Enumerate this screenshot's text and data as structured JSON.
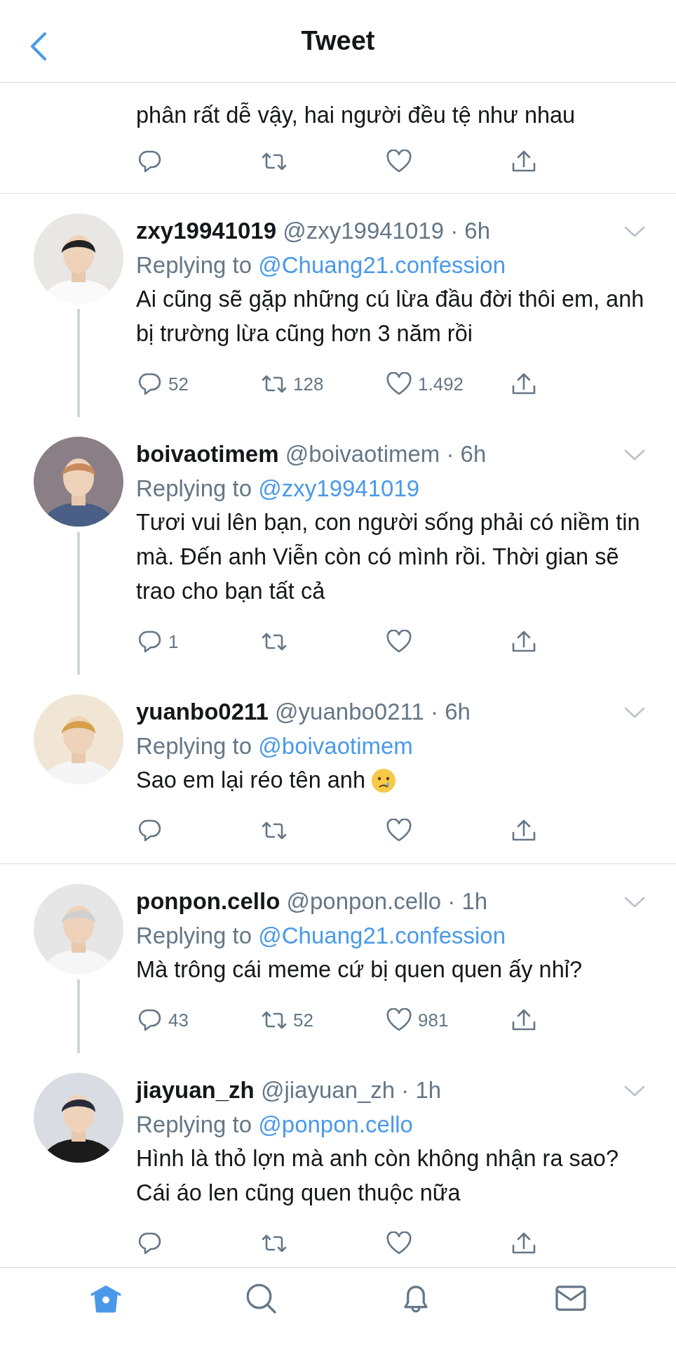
{
  "header": {
    "title": "Tweet"
  },
  "partial_tweet": {
    "body": "phân rất dễ vậy, hai người đều tệ như nhau"
  },
  "threads": [
    {
      "tweets": [
        {
          "name": "zxy19941019",
          "meta": "@zxy19941019 · 6h",
          "replying_label": "Replying to",
          "replying_to": "@Chuang21.confession",
          "body": "Ai cũng sẽ gặp những cú lừa đầu đời thôi em, anh bị trường lừa cũng hơn 3 năm rồi",
          "emoji": false,
          "thread_line": true,
          "replies": "52",
          "retweets": "128",
          "likes": "1.492"
        },
        {
          "name": "boivaotimem",
          "meta": "@boivaotimem · 6h",
          "replying_label": "Replying to",
          "replying_to": "@zxy19941019",
          "body": "Tươi vui lên bạn, con người sống phải có niềm tin mà. Đến anh Viễn còn có mình rồi. Thời gian sẽ trao cho bạn tất cả",
          "emoji": false,
          "thread_line": true,
          "replies": "1"
        },
        {
          "name": "yuanbo0211",
          "meta": "@yuanbo0211 · 6h",
          "replying_label": "Replying to",
          "replying_to": "@boivaotimem",
          "body": "Sao em lại réo tên anh",
          "emoji": true,
          "thread_line": false
        }
      ]
    },
    {
      "tweets": [
        {
          "name": "ponpon.cello",
          "meta": "@ponpon.cello · 1h",
          "replying_label": "Replying to",
          "replying_to": "@Chuang21.confession",
          "body": "Mà trông cái meme cứ bị quen quen ấy nhỉ?",
          "emoji": false,
          "thread_line": true,
          "replies": "43",
          "retweets": "52",
          "likes": "981"
        },
        {
          "name": "jiayuan_zh",
          "meta": "@jiayuan_zh · 1h",
          "replying_label": "Replying to",
          "replying_to": "@ponpon.cello",
          "body": "Hình là thỏ lợn mà anh còn không nhận ra sao? Cái áo len cũng quen thuộc nữa",
          "emoji": false,
          "thread_line": false
        }
      ]
    }
  ],
  "tab_bar": [
    {
      "kind": "home",
      "selected": true
    },
    {
      "kind": "search",
      "selected": false
    },
    {
      "kind": "notifications",
      "selected": false
    },
    {
      "kind": "messages",
      "selected": false
    }
  ]
}
